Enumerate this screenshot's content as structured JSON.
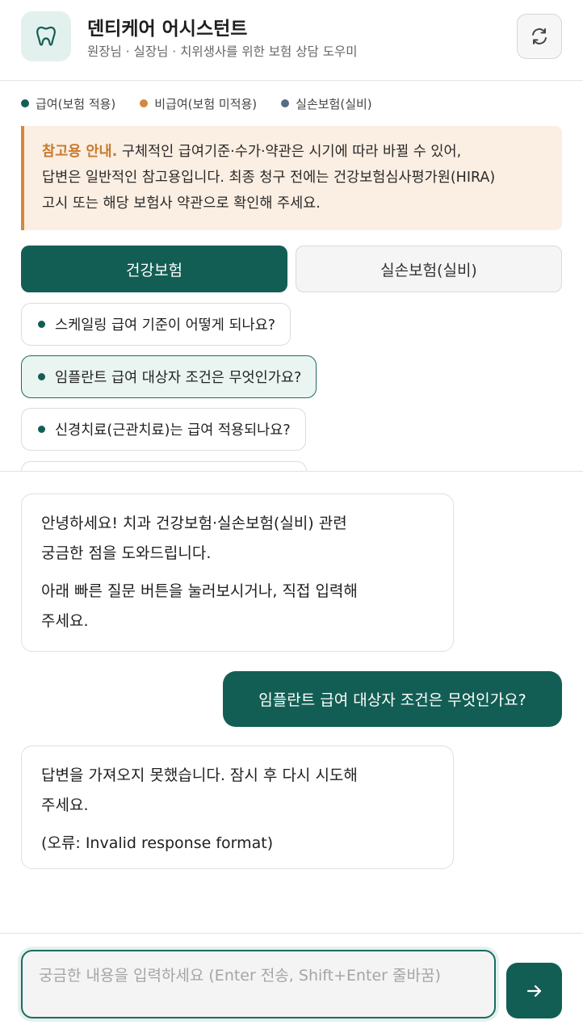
{
  "header": {
    "title": "덴티케어 어시스턴트",
    "subtitle": "원장님 · 실장님 · 치위생사를 위한 보험 상담 도우미",
    "logo_icon": "tooth-icon",
    "refresh_icon": "refresh-icon"
  },
  "legend": [
    {
      "label": "급여(보험 적용)",
      "color": "#135e54"
    },
    {
      "label": "비급여(보험 미적용)",
      "color": "#d18a3e"
    },
    {
      "label": "실손보험(실비)",
      "color": "#556b8a"
    }
  ],
  "notice": {
    "title": "참고용 안내.",
    "line1": " 구체적인 급여기준·수가·약관은 시기에 따라 바뀔 수 있어,",
    "line2": "답변은 일반적인 참고용입니다. 최종 청구 전에는 건강보험심사평가원(HIRA)",
    "line3": "고시 또는 해당 보험사 약관으로 확인해 주세요."
  },
  "tabs": [
    {
      "label": "건강보험",
      "active": true
    },
    {
      "label": "실손보험(실비)",
      "active": false
    }
  ],
  "quick_questions": [
    "스케일링 급여 기준이 어떻게 되나요?",
    "임플란트 급여 대상자 조건은 무엇인가요?",
    "신경치료(근관치료)는 급여 적용되나요?"
  ],
  "messages": {
    "bot1_p1_l1": "안녕하세요! 치과 건강보험·실손보험(실비) 관련",
    "bot1_p1_l2": "궁금한 점을 도와드립니다.",
    "bot1_p2_l1": "아래 빠른 질문 버튼을 눌러보시거나, 직접 입력해",
    "bot1_p2_l2": "주세요.",
    "user1": "임플란트 급여 대상자 조건은 무엇인가요?",
    "bot2_p1_l1": "답변을 가져오지 못했습니다. 잠시 후 다시 시도해",
    "bot2_p1_l2": "주세요.",
    "bot2_p2": "(오류: Invalid response format)"
  },
  "input": {
    "placeholder": "궁금한 내용을 입력하세요 (Enter 전송, Shift+Enter 줄바꿈)",
    "send_icon": "arrow-right-icon"
  }
}
